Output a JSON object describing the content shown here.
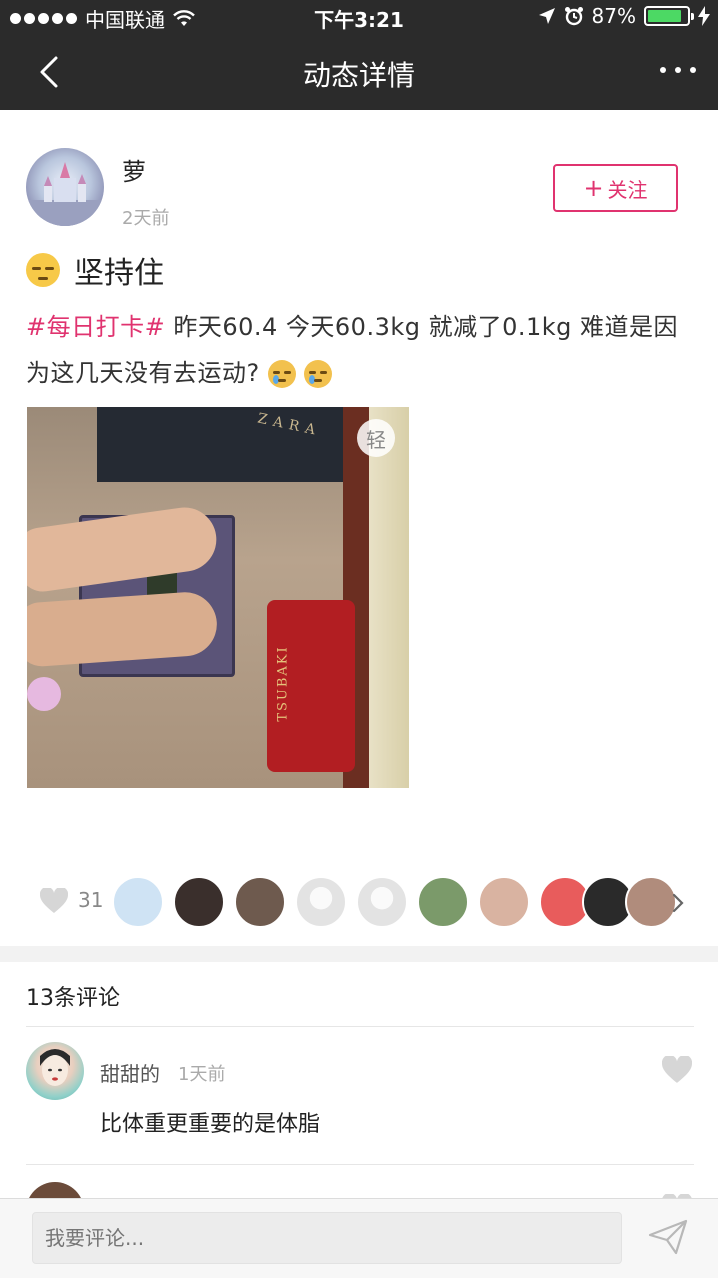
{
  "status_bar": {
    "carrier": "中国联通",
    "time": "下午3:21",
    "battery_percent": "87%",
    "battery_level": 0.87
  },
  "nav": {
    "title": "动态详情",
    "back_icon": "chevron-left-icon",
    "more_icon": "more-dots-icon"
  },
  "post": {
    "author": "萝",
    "time_ago": "2天前",
    "follow_label": "关注",
    "title": "坚持住",
    "title_emoji": "unamused-face-emoji",
    "tag": "#每日打卡#",
    "body": " 昨天60.4 今天60.3kg 就减了0.1kg 难道是因为这几天没有去运动?",
    "body_emojis": [
      "crying-face-emoji",
      "loudly-crying-face-emoji"
    ],
    "photo_badge": "轻",
    "photo_text_bag": "ZARA",
    "photo_text_mat": "TSUBAKI"
  },
  "likes": {
    "count": "31",
    "avatar_colors": [
      "#cfe3f4",
      "#3a2f2c",
      "#6e5a4e",
      "#eeeeee",
      "#eeeeee",
      "#7b9a6a",
      "#d9b3a1",
      "#e85c5c",
      "#2a2a2a",
      "#b08c7c"
    ]
  },
  "comments": {
    "title": "13条评论",
    "items": [
      {
        "name": "甜甜的",
        "time": "1天前",
        "text": "比体重更重要的是体脂"
      }
    ]
  },
  "input": {
    "placeholder": "我要评论..."
  },
  "colors": {
    "accent": "#e0336f",
    "navbar": "#2b2b2b"
  }
}
